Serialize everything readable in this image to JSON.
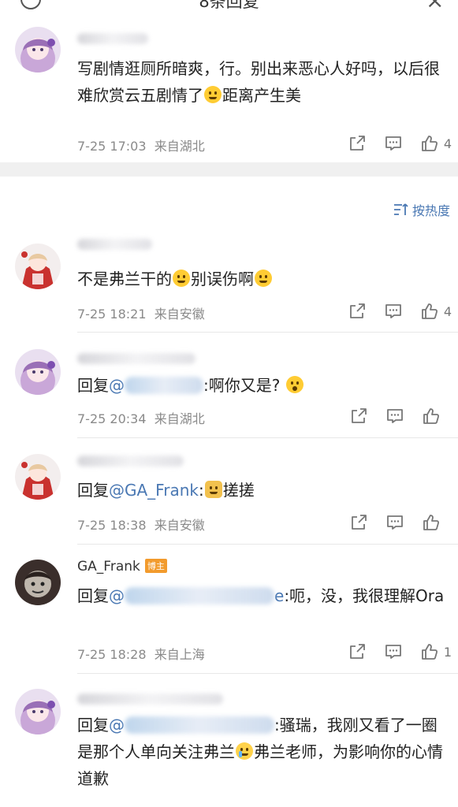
{
  "header": {
    "title": "8条回复"
  },
  "sort": {
    "label": "按热度"
  },
  "comments": [
    {
      "text": "写剧情逛厕所暗爽，行。别出来恶心人好吗，以后很难欣赏云五剧情了",
      "text_after": "距离产生美",
      "emoji": "sweat-emoji",
      "time": "7-25 17:03",
      "location": "来自湖北",
      "likes": "4"
    },
    {
      "text": "不是弗兰干的",
      "emoji": "laugh-cry-emoji",
      "text_mid": "别误伤啊",
      "emoji2": "shush-emoji",
      "time": "7-25 18:21",
      "location": "来自安徽",
      "likes": "4"
    },
    {
      "reply_prefix": "回复",
      "mention": "@",
      "text": ":啊你又是?",
      "emoji": "surprise-emoji",
      "time": "7-25 20:34",
      "location": "来自湖北",
      "likes": ""
    },
    {
      "reply_prefix": "回复",
      "mention": "@GA_Frank",
      "text": ":",
      "emoji": "cat-emoji",
      "text_after": "搓搓",
      "time": "7-25 18:38",
      "location": "来自安徽",
      "likes": ""
    },
    {
      "name": "GA_Frank",
      "badge": "博主",
      "reply_prefix": "回复",
      "mention": "@",
      "mention_tail": "e",
      "text": ":呃，没，我很理解Ora",
      "time": "7-25 18:28",
      "location": "来自上海",
      "likes": "1"
    },
    {
      "reply_prefix": "回复",
      "mention": "@",
      "text": ":骚瑞，我刚又看了一圈是那个人单向关注弗兰",
      "emoji": "cry-emoji",
      "text_after": "弗兰老师，为影响你的心情道歉"
    }
  ],
  "colors": {
    "link": "#4a78b3",
    "meta": "#8a8a8a",
    "badge": "#f29b2d"
  }
}
